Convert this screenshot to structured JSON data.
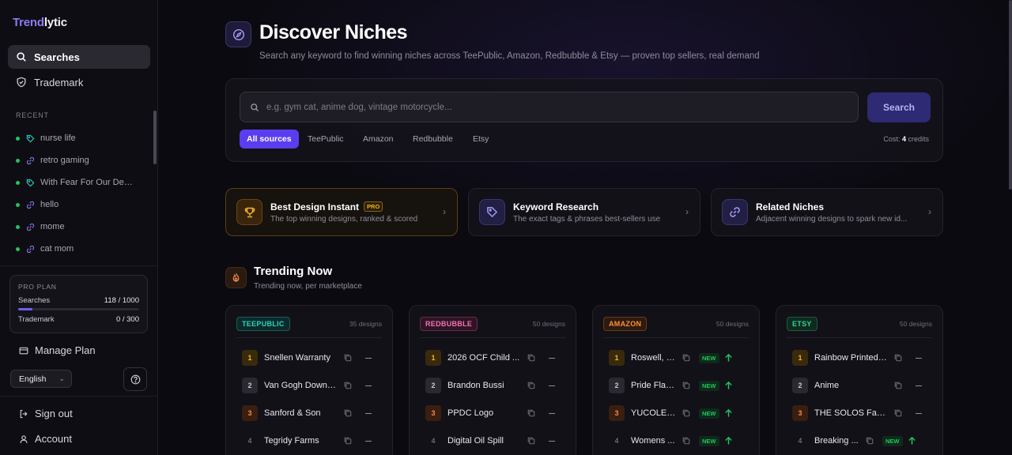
{
  "brand": {
    "part1": "Trend",
    "part2": "lytic"
  },
  "nav": [
    {
      "label": "Searches",
      "icon": "search-icon",
      "active": true
    },
    {
      "label": "Trademark",
      "icon": "shield-icon",
      "active": false
    }
  ],
  "recent": {
    "heading": "RECENT",
    "items": [
      {
        "label": "nurse life",
        "icon": "tag-icon"
      },
      {
        "label": "retro gaming",
        "icon": "link-icon"
      },
      {
        "label": "With Fear For Our Dem…",
        "icon": "tag-icon"
      },
      {
        "label": "hello",
        "icon": "link-icon"
      },
      {
        "label": "mome",
        "icon": "link-icon"
      },
      {
        "label": "cat mom",
        "icon": "link-icon"
      }
    ]
  },
  "plan": {
    "title": "PRO PLAN",
    "searches_label": "Searches",
    "searches_value": "118 / 1000",
    "searches_fraction": 0.118,
    "trademark_label": "Trademark",
    "trademark_value": "0 / 300",
    "trademark_fraction": 0
  },
  "manage_plan": "Manage Plan",
  "language": "English",
  "sign_out": "Sign out",
  "account": "Account",
  "page": {
    "title": "Discover Niches",
    "subtitle": "Search any keyword to find winning niches across TeePublic, Amazon, Redbubble & Etsy — proven top sellers, real demand"
  },
  "search": {
    "placeholder": "e.g. gym cat, anime dog, vintage motorcycle...",
    "button": "Search",
    "sources": [
      "All sources",
      "TeePublic",
      "Amazon",
      "Redbubble",
      "Etsy"
    ],
    "cost_label": "Cost:",
    "cost_value": "4",
    "cost_unit": "credits"
  },
  "features": [
    {
      "title": "Best Design Instant",
      "badge": "PRO",
      "desc": "The top winning designs, ranked & scored",
      "icon": "trophy-icon"
    },
    {
      "title": "Keyword Research",
      "badge": "",
      "desc": "The exact tags & phrases best-sellers use",
      "icon": "tag-icon"
    },
    {
      "title": "Related Niches",
      "badge": "",
      "desc": "Adjacent winning designs to spark new id...",
      "icon": "link-icon"
    }
  ],
  "trending": {
    "title": "Trending Now",
    "subtitle": "Trending now, per marketplace",
    "markets": [
      {
        "name": "TEEPUBLIC",
        "count": "35 designs",
        "color": "#2dd4bf",
        "bg": "#0d2a2a",
        "border": "#1d5a55",
        "rows": [
          {
            "rank": "1",
            "name": "Snellen Warranty",
            "new": false
          },
          {
            "rank": "2",
            "name": "Van Gogh Down ...",
            "new": false
          },
          {
            "rank": "3",
            "name": "Sanford & Son",
            "new": false
          },
          {
            "rank": "4",
            "name": "Tegridy Farms",
            "new": false
          }
        ]
      },
      {
        "name": "REDBUBBLE",
        "count": "50 designs",
        "color": "#f472b6",
        "bg": "#2e1424",
        "border": "#6a2a50",
        "rows": [
          {
            "rank": "1",
            "name": "2026 OCF Child ...",
            "new": false
          },
          {
            "rank": "2",
            "name": "Brandon Bussi",
            "new": false
          },
          {
            "rank": "3",
            "name": "PPDC Logo",
            "new": false
          },
          {
            "rank": "4",
            "name": "Digital Oil Spill",
            "new": false
          }
        ]
      },
      {
        "name": "AMAZON",
        "count": "50 designs",
        "color": "#fb923c",
        "bg": "#2e1a0e",
        "border": "#6a3a14",
        "rows": [
          {
            "rank": "1",
            "name": "Roswell, N...",
            "new": true
          },
          {
            "rank": "2",
            "name": "Pride Flag ...",
            "new": true
          },
          {
            "rank": "3",
            "name": "YUCOLEN ...",
            "new": true
          },
          {
            "rank": "4",
            "name": "Womens ...",
            "new": true
          }
        ]
      },
      {
        "name": "ETSY",
        "count": "50 designs",
        "color": "#34d399",
        "bg": "#0f2a1e",
        "border": "#1d5a3d",
        "rows": [
          {
            "rank": "1",
            "name": "Rainbow Printed ...",
            "new": false
          },
          {
            "rank": "2",
            "name": "Anime",
            "new": false
          },
          {
            "rank": "3",
            "name": "THE SOLOS Famil...",
            "new": false
          },
          {
            "rank": "4",
            "name": "Breaking ...",
            "new": true
          }
        ]
      }
    ],
    "new_label": "NEW"
  }
}
